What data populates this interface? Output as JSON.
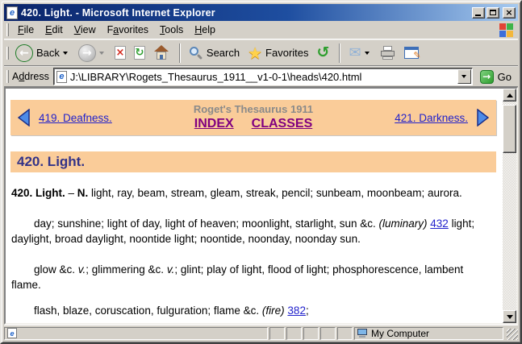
{
  "window": {
    "title": "420. Light. - Microsoft Internet Explorer"
  },
  "colors": {
    "titlebar_gradient_start": "#0A246A",
    "titlebar_gradient_end": "#A6CAF0",
    "chrome": "#D4D0C8",
    "accent_peach": "#FACC99",
    "heading_text": "#333388",
    "link_blue": "#2222CC",
    "link_visited_purple": "#800080"
  },
  "icons": {
    "back_arrow": "←",
    "forward_arrow": "→",
    "stop_x": "×",
    "refresh": "↻",
    "history": "↺",
    "favorites_star": "★",
    "mail_envelope": "✉",
    "edit_pencil": "✎",
    "go_arrow": "→",
    "nav_prev_triangle": "left-triangle",
    "nav_next_triangle": "right-triangle",
    "ie_page_letter": "e",
    "close": "×"
  },
  "menu": {
    "items": [
      {
        "label": "File",
        "u": 0
      },
      {
        "label": "Edit",
        "u": 0
      },
      {
        "label": "View",
        "u": 0
      },
      {
        "label": "Favorites",
        "u": 1
      },
      {
        "label": "Tools",
        "u": 0
      },
      {
        "label": "Help",
        "u": 0
      }
    ]
  },
  "toolbar": {
    "back": "Back",
    "search": "Search",
    "favorites": "Favorites"
  },
  "address": {
    "label": {
      "label": "Address",
      "u": 1
    },
    "value": "J:\\LIBRARY\\Rogets_Thesaurus_1911__v1-0-1\\heads\\420.html",
    "go": "Go"
  },
  "content": {
    "nav": {
      "prev": "419. Deafness.",
      "title": "Roget's Thesaurus 1911",
      "index": "INDEX",
      "classes": "CLASSES",
      "next": "421. Darkness."
    },
    "heading": "420. Light.",
    "paragraphs": [
      {
        "segments": [
          {
            "t": "420. Light.",
            "s": "b"
          },
          {
            "t": " – ",
            "s": ""
          },
          {
            "t": "N.",
            "s": "b"
          },
          {
            "t": " light, ray, beam, stream, gleam, streak, pencil; sunbeam, moonbeam; aurora.",
            "s": ""
          }
        ]
      },
      {
        "segments": [
          {
            "t": "day; sunshine; light of day, light of heaven; moonlight, starlight, sun &c. ",
            "s": ""
          },
          {
            "t": "(luminary)",
            "s": "i"
          },
          {
            "t": " ",
            "s": ""
          },
          {
            "t": "432",
            "s": "link"
          },
          {
            "t": " light; daylight, broad daylight, noontide light; noontide, noonday, noonday sun.",
            "s": ""
          }
        ]
      },
      {
        "segments": [
          {
            "t": "glow &c. ",
            "s": ""
          },
          {
            "t": "v.",
            "s": "i"
          },
          {
            "t": "; glimmering &c. ",
            "s": ""
          },
          {
            "t": "v.",
            "s": "i"
          },
          {
            "t": "; glint; play of light, flood of light; phosphorescence, lambent flame.",
            "s": ""
          }
        ]
      },
      {
        "segments": [
          {
            "t": "flash, blaze, coruscation, fulguration; flame &c. ",
            "s": ""
          },
          {
            "t": "(fire)",
            "s": "i"
          },
          {
            "t": " ",
            "s": ""
          },
          {
            "t": "382",
            "s": "link"
          },
          {
            "t": ";",
            "s": ""
          }
        ]
      }
    ]
  },
  "status": {
    "zone": "My Computer"
  }
}
